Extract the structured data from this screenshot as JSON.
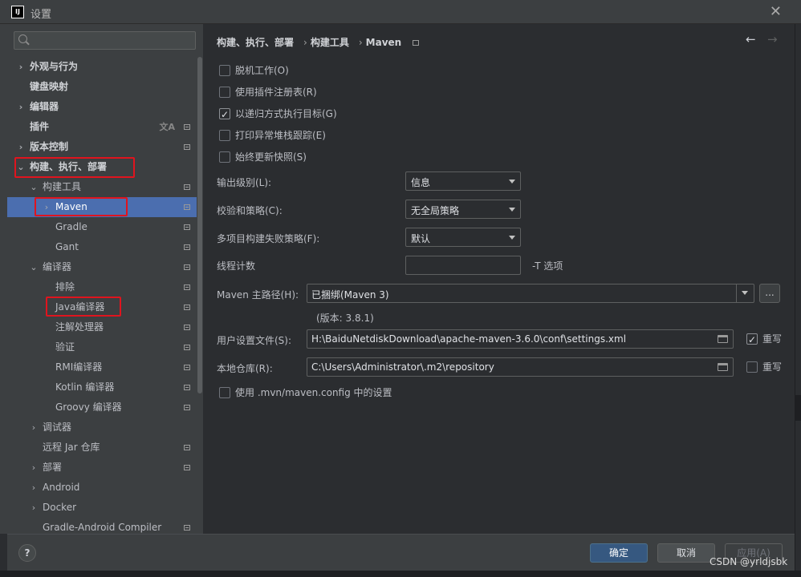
{
  "window": {
    "title": "设置",
    "app_icon_text": "IJ"
  },
  "search": {
    "placeholder": ""
  },
  "sidebar": {
    "items": [
      {
        "label": "外观与行为",
        "arrow": "›",
        "level": 0,
        "bold": true
      },
      {
        "label": "键盘映射",
        "arrow": "",
        "level": 0,
        "bold": true
      },
      {
        "label": "编辑器",
        "arrow": "›",
        "level": 0,
        "bold": true
      },
      {
        "label": "插件",
        "arrow": "",
        "level": 0,
        "bold": true,
        "translate": true,
        "pin": true
      },
      {
        "label": "版本控制",
        "arrow": "›",
        "level": 0,
        "bold": true,
        "pin": true
      },
      {
        "label": "构建、执行、部署",
        "arrow": "⌄",
        "level": 0,
        "bold": true
      },
      {
        "label": "构建工具",
        "arrow": "⌄",
        "level": 1,
        "pin": true
      },
      {
        "label": "Maven",
        "arrow": "›",
        "level": 2,
        "selected": true,
        "pin": true
      },
      {
        "label": "Gradle",
        "arrow": "",
        "level": 2,
        "pin": true
      },
      {
        "label": "Gant",
        "arrow": "",
        "level": 2,
        "pin": true
      },
      {
        "label": "编译器",
        "arrow": "⌄",
        "level": 1,
        "pin": true
      },
      {
        "label": "排除",
        "arrow": "",
        "level": 2,
        "pin": true
      },
      {
        "label": "Java编译器",
        "arrow": "",
        "level": 2,
        "pin": true
      },
      {
        "label": "注解处理器",
        "arrow": "",
        "level": 2,
        "pin": true
      },
      {
        "label": "验证",
        "arrow": "",
        "level": 2,
        "pin": true
      },
      {
        "label": "RMI编译器",
        "arrow": "",
        "level": 2,
        "pin": true
      },
      {
        "label": "Kotlin 编译器",
        "arrow": "",
        "level": 2,
        "pin": true
      },
      {
        "label": "Groovy 编译器",
        "arrow": "",
        "level": 2,
        "pin": true
      },
      {
        "label": "调试器",
        "arrow": "›",
        "level": 1
      },
      {
        "label": "远程 Jar 仓库",
        "arrow": "",
        "level": 1,
        "pin": true
      },
      {
        "label": "部署",
        "arrow": "›",
        "level": 1,
        "pin": true
      },
      {
        "label": "Android",
        "arrow": "›",
        "level": 1
      },
      {
        "label": "Docker",
        "arrow": "›",
        "level": 1
      },
      {
        "label": "Gradle-Android Compiler",
        "arrow": "",
        "level": 1,
        "pin": true
      }
    ]
  },
  "breadcrumb": {
    "part1": "构建、执行、部署",
    "sep": "›",
    "part2": "构建工具",
    "part3": "Maven"
  },
  "checkboxes": [
    {
      "label": "脱机工作(O)",
      "checked": false
    },
    {
      "label": "使用插件注册表(R)",
      "checked": false
    },
    {
      "label": "以递归方式执行目标(G)",
      "checked": true
    },
    {
      "label": "打印异常堆栈跟踪(E)",
      "checked": false
    },
    {
      "label": "始终更新快照(S)",
      "checked": false
    }
  ],
  "fields": {
    "output_level_label": "输出级别(L):",
    "output_level_value": "信息",
    "checksum_label": "校验和策略(C):",
    "checksum_value": "无全局策略",
    "multiproject_label": "多项目构建失败策略(F):",
    "multiproject_value": "默认",
    "threads_label": "线程计数",
    "threads_value": "",
    "threads_hint": "-T 选项",
    "maven_home_label": "Maven 主路径(H):",
    "maven_home_value": "已捆绑(Maven 3)",
    "ellipsis": "...",
    "version_note": "(版本: 3.8.1)",
    "user_settings_label": "用户设置文件(S):",
    "user_settings_value": "H:\\BaiduNetdiskDownload\\apache-maven-3.6.0\\conf\\settings.xml",
    "override1_label": "重写",
    "override1_checked": true,
    "local_repo_label": "本地仓库(R):",
    "local_repo_value": "C:\\Users\\Administrator\\.m2\\repository",
    "override2_label": "重写",
    "override2_checked": false,
    "mvn_config_label": "使用 .mvn/maven.config 中的设置",
    "mvn_config_checked": false
  },
  "footer": {
    "help": "?",
    "ok": "确定",
    "cancel": "取消",
    "apply": "应用(A)"
  },
  "watermark": "CSDN @yrldjsbk",
  "colors": {
    "accent": "#4b6eaf",
    "primary_button": "#365880",
    "annotation_box": "#e0141e"
  }
}
